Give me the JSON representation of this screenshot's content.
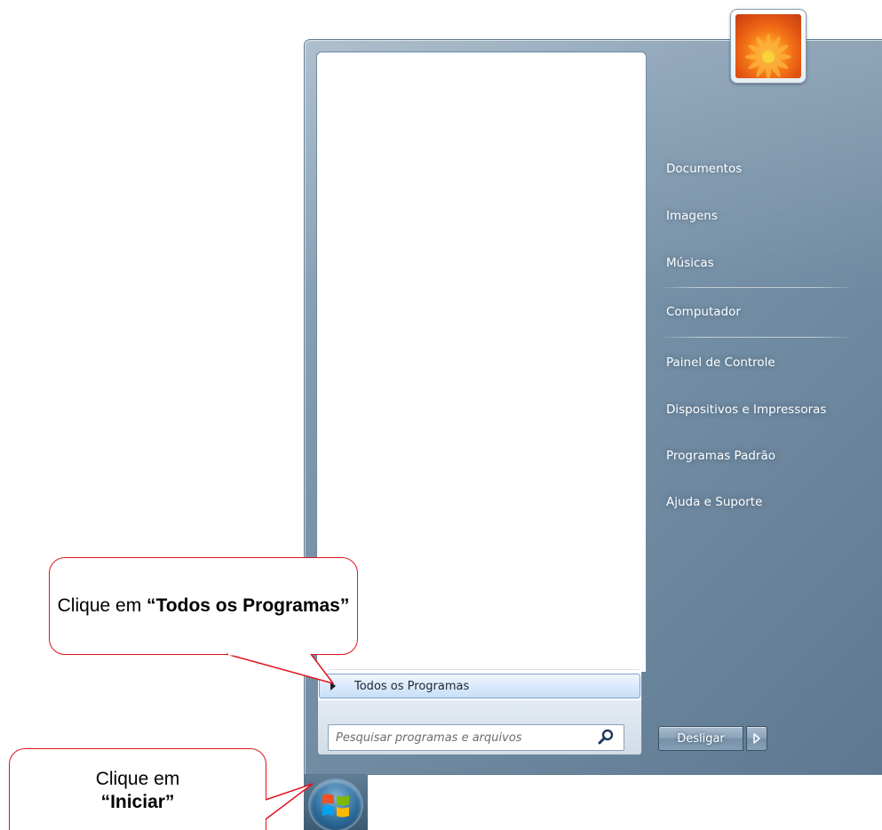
{
  "start_menu": {
    "all_programs_label": "Todos os Programas",
    "search_placeholder": "Pesquisar programas e arquivos",
    "right_items": [
      "Documentos",
      "Imagens",
      "Músicas",
      "Computador",
      "Painel de Controle",
      "Dispositivos e Impressoras",
      "Programas Padrão",
      "Ajuda e Suporte"
    ],
    "shutdown_label": "Desligar",
    "icons": {
      "search": "search-icon",
      "shutdown_options": "chevron-right-icon",
      "start_orb": "windows-logo-icon",
      "user": "user-picture-icon"
    }
  },
  "callouts": {
    "all_programs": {
      "prefix": "Clique em ",
      "bold": "“Todos os Programas”"
    },
    "start": {
      "prefix": "Clique em",
      "bold": "“Iniciar”"
    }
  },
  "colors": {
    "callout_border": "#e0141e",
    "menu_frame": "#7d97ad",
    "highlight": "#dcebfc"
  }
}
